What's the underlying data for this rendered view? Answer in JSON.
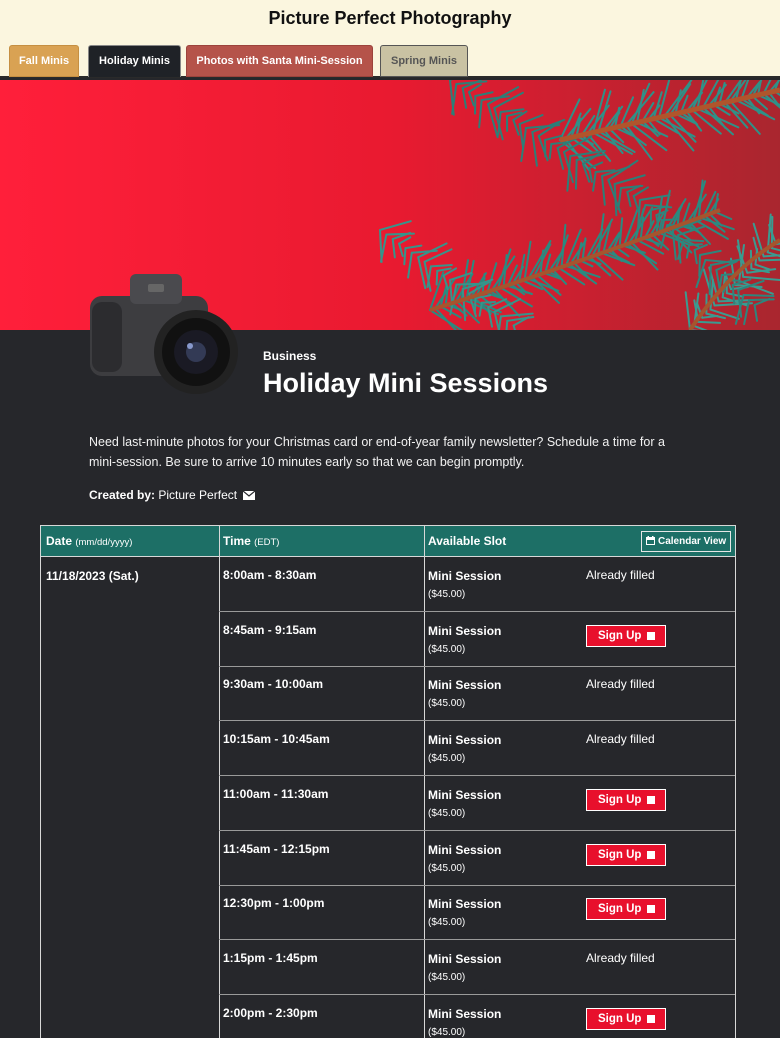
{
  "header": {
    "title": "Picture Perfect Photography"
  },
  "tabs": [
    {
      "label": "Fall Minis"
    },
    {
      "label": "Holiday Minis"
    },
    {
      "label": "Photos with Santa Mini-Session"
    },
    {
      "label": "Spring Minis"
    }
  ],
  "event": {
    "category": "Business",
    "title": "Holiday Mini Sessions",
    "description": "Need last-minute photos for your Christmas card or end-of-year family newsletter? Schedule a time for a mini-session. Be sure to arrive 10 minutes early so that we can begin promptly.",
    "created_by_label": "Created by:",
    "created_by_name": "Picture Perfect"
  },
  "table": {
    "col_date": "Date",
    "col_date_hint": "(mm/dd/yyyy)",
    "col_time": "Time",
    "col_time_hint": "(EDT)",
    "col_slot": "Available Slot",
    "calendar_view": "Calendar View",
    "date": "11/18/2023 (Sat.)",
    "rows": [
      {
        "time": "8:00am - 8:30am",
        "slot": "Mini Session",
        "price": "($45.00)",
        "status": "Already filled"
      },
      {
        "time": "8:45am - 9:15am",
        "slot": "Mini Session",
        "price": "($45.00)",
        "status": "Sign Up"
      },
      {
        "time": "9:30am - 10:00am",
        "slot": "Mini Session",
        "price": "($45.00)",
        "status": "Already filled"
      },
      {
        "time": "10:15am - 10:45am",
        "slot": "Mini Session",
        "price": "($45.00)",
        "status": "Already filled"
      },
      {
        "time": "11:00am - 11:30am",
        "slot": "Mini Session",
        "price": "($45.00)",
        "status": "Sign Up"
      },
      {
        "time": "11:45am - 12:15pm",
        "slot": "Mini Session",
        "price": "($45.00)",
        "status": "Sign Up"
      },
      {
        "time": "12:30pm - 1:00pm",
        "slot": "Mini Session",
        "price": "($45.00)",
        "status": "Sign Up"
      },
      {
        "time": "1:15pm - 1:45pm",
        "slot": "Mini Session",
        "price": "($45.00)",
        "status": "Already filled"
      },
      {
        "time": "2:00pm - 2:30pm",
        "slot": "Mini Session",
        "price": "($45.00)",
        "status": "Sign Up"
      }
    ]
  },
  "icons": {
    "mail": "envelope-icon",
    "calendar": "calendar-icon",
    "checkbox": "checkbox-icon"
  },
  "colors": {
    "header_bg": "#fbf6df",
    "table_header": "#1d6f66",
    "signup_red": "#e8102c",
    "banner_red": "#ff1f3a"
  }
}
